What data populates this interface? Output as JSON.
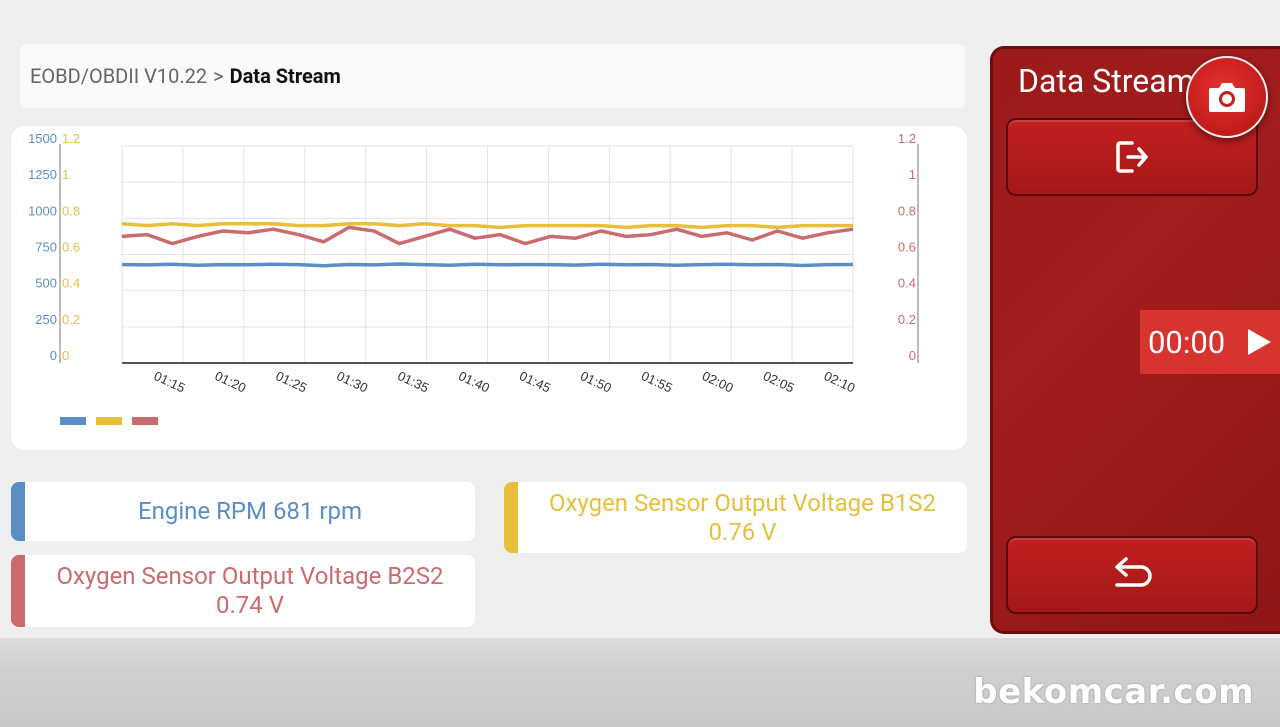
{
  "breadcrumb": {
    "parent": "EOBD/OBDII V10.22",
    "separator": ">",
    "current": "Data Stream"
  },
  "side_panel": {
    "title": "Data Stream",
    "timer": "00:00",
    "icons": {
      "camera": "camera-icon",
      "exit": "exit-icon",
      "play": "play-icon",
      "back": "back-icon"
    }
  },
  "colors": {
    "rpm": "#5b8ec4",
    "b1s2": "#e7bf3d",
    "b2s2": "#c96b6f",
    "panel": "#a21d1d",
    "accent": "#d8342f"
  },
  "readouts": {
    "rpm": {
      "line1": "Engine RPM 681 rpm",
      "line2": ""
    },
    "b1s2": {
      "line1": "Oxygen Sensor Output Voltage B1S2",
      "line2": "0.76 V"
    },
    "b2s2": {
      "line1": "Oxygen Sensor Output Voltage B2S2",
      "line2": "0.74 V"
    }
  },
  "watermark": "bekomcar.com",
  "chart_data": {
    "type": "line",
    "x_ticks": [
      "01:15",
      "01:20",
      "01:25",
      "01:30",
      "01:35",
      "01:40",
      "01:45",
      "01:50",
      "01:55",
      "02:00",
      "02:05",
      "02:10"
    ],
    "x_range": [
      "01:10",
      "02:10"
    ],
    "y_left_rpm": {
      "ticks": [
        "1500",
        "1250",
        "1000",
        "750",
        "500",
        "250",
        "0"
      ],
      "range": [
        0,
        1500
      ]
    },
    "y_left_volt": {
      "ticks": [
        "1.2",
        "1",
        "0.8",
        "0.6",
        "0.4",
        "0.2",
        "0"
      ],
      "range": [
        0,
        1.2
      ]
    },
    "y_right_volt": {
      "ticks": [
        "1.2",
        "1",
        "0.8",
        "0.6",
        "0.4",
        "0.2",
        "0"
      ],
      "range": [
        0,
        1.2
      ]
    },
    "grid": true,
    "legend": "bottom-left",
    "series": [
      {
        "key": "rpm",
        "color": "#5b8ec4",
        "axis": "left_rpm",
        "values": [
          680,
          678,
          682,
          676,
          680,
          679,
          683,
          680,
          672,
          681,
          678,
          684,
          680,
          676,
          682,
          679,
          681,
          680,
          677,
          682,
          679,
          681,
          676,
          680,
          683,
          679,
          681,
          674,
          680,
          681
        ]
      },
      {
        "key": "b1s2",
        "color": "#e7bf3d",
        "axis": "left_volt",
        "values": [
          0.77,
          0.76,
          0.77,
          0.76,
          0.77,
          0.77,
          0.77,
          0.76,
          0.76,
          0.77,
          0.77,
          0.76,
          0.77,
          0.76,
          0.76,
          0.75,
          0.76,
          0.76,
          0.76,
          0.76,
          0.75,
          0.76,
          0.76,
          0.75,
          0.76,
          0.76,
          0.75,
          0.76,
          0.76,
          0.76
        ]
      },
      {
        "key": "b2s2",
        "color": "#c96b6f",
        "axis": "right_volt",
        "values": [
          0.7,
          0.71,
          0.66,
          0.7,
          0.73,
          0.72,
          0.74,
          0.71,
          0.67,
          0.75,
          0.73,
          0.66,
          0.7,
          0.74,
          0.69,
          0.71,
          0.66,
          0.7,
          0.69,
          0.73,
          0.7,
          0.71,
          0.74,
          0.7,
          0.72,
          0.68,
          0.73,
          0.69,
          0.72,
          0.74
        ]
      }
    ]
  }
}
